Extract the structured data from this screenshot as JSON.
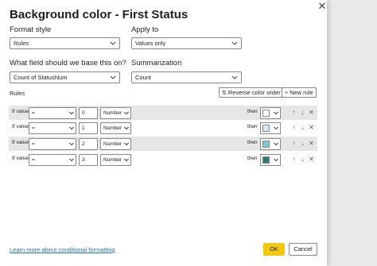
{
  "dialog": {
    "title": "Background color - First Status",
    "close_icon": "close-icon"
  },
  "format_style": {
    "label": "Format style",
    "value": "Rules"
  },
  "apply_to": {
    "label": "Apply to",
    "value": "Values only"
  },
  "base_field": {
    "label": "What field should we base this on?",
    "value": "Count of StatusNum"
  },
  "summarization": {
    "label": "Summarization",
    "value": "Count"
  },
  "rules_section": {
    "label": "Rules",
    "reverse_button": "Reverse color order",
    "new_rule_button": "New rule"
  },
  "rules": [
    {
      "if_label": "If value",
      "operator": "=",
      "value": "0",
      "type": "Number",
      "then_label": "then",
      "color": "#ffffff"
    },
    {
      "if_label": "If value",
      "operator": "=",
      "value": "1",
      "type": "Number",
      "then_label": "then",
      "color": "#d2ecf4"
    },
    {
      "if_label": "If value",
      "operator": "=",
      "value": "2",
      "type": "Number",
      "then_label": "then",
      "color": "#7fc8cf"
    },
    {
      "if_label": "If value",
      "operator": "=",
      "value": "3",
      "type": "Number",
      "then_label": "then",
      "color": "#2f7a77"
    }
  ],
  "footer": {
    "link": "Learn more about conditional formatting",
    "ok": "OK",
    "cancel": "Cancel"
  },
  "colors": {
    "accent": "#f2c811",
    "link": "#1b73c8",
    "rule_band": "#e6e6e6"
  }
}
